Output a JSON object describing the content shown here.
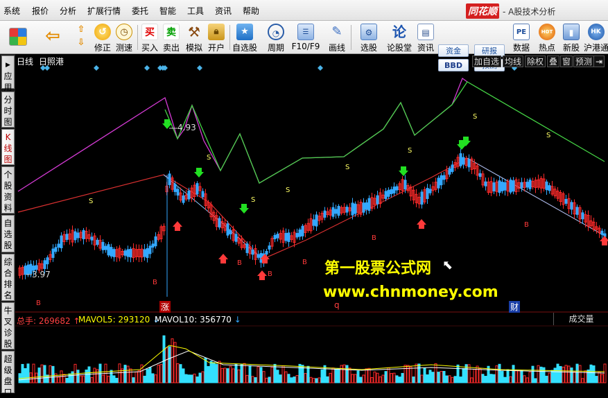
{
  "menubar": {
    "items": [
      "系统",
      "报价",
      "分析",
      "扩展行情",
      "委托",
      "智能",
      "工具",
      "资讯",
      "帮助"
    ],
    "brand": "同花顺",
    "subtitle": "- A股技术分析"
  },
  "toolbar": {
    "buttons": [
      {
        "label": "",
        "icon": "windows-logo-icon"
      },
      {
        "label": "",
        "icon": "back-arrow-icon"
      },
      {
        "label": "",
        "icon": "up-down-arrows-icon"
      },
      {
        "label": "修正",
        "icon": "revise-icon"
      },
      {
        "label": "测速",
        "icon": "speed-test-icon"
      },
      {
        "label": "买入",
        "icon": "buy-icon",
        "glyph": "买"
      },
      {
        "label": "卖出",
        "icon": "sell-icon",
        "glyph": "卖"
      },
      {
        "label": "模拟",
        "icon": "hammer-icon"
      },
      {
        "label": "开户",
        "icon": "lock-icon"
      },
      {
        "label": "自选股",
        "icon": "star-folder-icon"
      },
      {
        "label": "周期",
        "icon": "clock-icon"
      },
      {
        "label": "F10/F9",
        "icon": "f10-icon"
      },
      {
        "label": "画线",
        "icon": "pencil-icon"
      },
      {
        "label": "选股",
        "icon": "stock-picker-icon"
      },
      {
        "label": "论股堂",
        "icon": "forum-icon",
        "glyph": "论"
      },
      {
        "label": "资讯",
        "icon": "news-icon"
      },
      {
        "label": "数据",
        "icon": "pe-data-icon",
        "glyph": "PE"
      },
      {
        "label": "热点",
        "icon": "hot-icon",
        "glyph": "HOT"
      },
      {
        "label": "新股",
        "icon": "new-stock-icon"
      },
      {
        "label": "沪港通",
        "icon": "shhk-icon",
        "glyph": "HK"
      }
    ],
    "small_buttons": {
      "zijin": "资金",
      "bbd": "BBD",
      "yanbao": "研报",
      "yuce": "预测"
    }
  },
  "left_tabs": [
    {
      "label": "应用"
    },
    {
      "label": "分时图"
    },
    {
      "label": "K线图"
    },
    {
      "label": "个股资料"
    },
    {
      "label": "自选股"
    },
    {
      "label": "综合排名"
    },
    {
      "label": "牛叉诊股"
    },
    {
      "label": "超级盘口"
    }
  ],
  "chart_header": {
    "period": "日线",
    "stock_name": "日照港",
    "right_buttons": [
      "加自选",
      "均线",
      "除权",
      "叠",
      "窗",
      "预测"
    ]
  },
  "price_annotations": {
    "high": "4.93",
    "low": "3.97"
  },
  "event_markers": {
    "zhang": "涨",
    "q": "q",
    "cai": "财"
  },
  "signal_labels": {
    "buy": "B",
    "sell": "S"
  },
  "volume_header": {
    "total": {
      "label": "总手",
      "value": "269682"
    },
    "mavol5": {
      "label": "MAVOL5",
      "value": "293120"
    },
    "mavol10": {
      "label": "MAVOL10",
      "value": "356770"
    },
    "panel_title": "成交量"
  },
  "watermark": {
    "line1": "第一股票公式网",
    "line2": "www.chnmoney.com"
  },
  "colors": {
    "up": "#ff2a2a",
    "down": "#33a8ff",
    "line_magenta": "#d23ad2",
    "line_green": "#45d445",
    "signal_red": "#ff3a3a",
    "signal_green": "#22e022",
    "watermark": "#ffff00"
  }
}
